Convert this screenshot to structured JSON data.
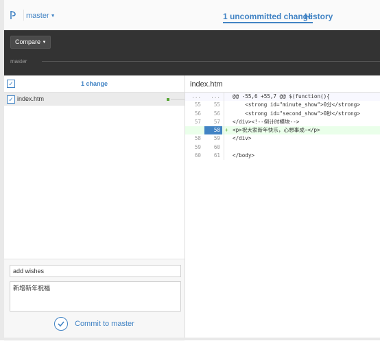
{
  "header": {
    "branch": "master",
    "tabs": [
      {
        "label": "1 uncommitted change"
      },
      {
        "label": "History"
      }
    ]
  },
  "toolbar": {
    "compare_label": "Compare",
    "branch_label": "master"
  },
  "changes": {
    "count_label": "1 change",
    "files": [
      {
        "name": "index.htm",
        "checked": true,
        "status": "added"
      }
    ]
  },
  "commit": {
    "summary": "add wishes",
    "description": "新增新年祝福",
    "button_label": "Commit to master"
  },
  "diff": {
    "filename": "index.htm",
    "lines": [
      {
        "old": "...",
        "new": "...",
        "marker": "",
        "code": "@@ -55,6 +55,7 @@ $(function(){",
        "type": "hunk"
      },
      {
        "old": "55",
        "new": "55",
        "marker": "",
        "code": "    <strong id=\"minute_show\">0分</strong>",
        "type": "context"
      },
      {
        "old": "56",
        "new": "56",
        "marker": "",
        "code": "    <strong id=\"second_show\">0秒</strong>",
        "type": "context"
      },
      {
        "old": "57",
        "new": "57",
        "marker": "",
        "code": "</div><!--倒计时模块-->",
        "type": "context"
      },
      {
        "old": "",
        "new": "58",
        "marker": "+",
        "code": "<p>祝大家新年快乐，心想事成~</p>",
        "type": "added"
      },
      {
        "old": "58",
        "new": "59",
        "marker": "",
        "code": "</div>",
        "type": "context"
      },
      {
        "old": "59",
        "new": "60",
        "marker": "",
        "code": "",
        "type": "context"
      },
      {
        "old": "60",
        "new": "61",
        "marker": "",
        "code": "</body>",
        "type": "context"
      }
    ]
  },
  "colors": {
    "accent": "#4183c4",
    "added_bg": "#eaffea",
    "toolbar_bg": "#333333"
  }
}
